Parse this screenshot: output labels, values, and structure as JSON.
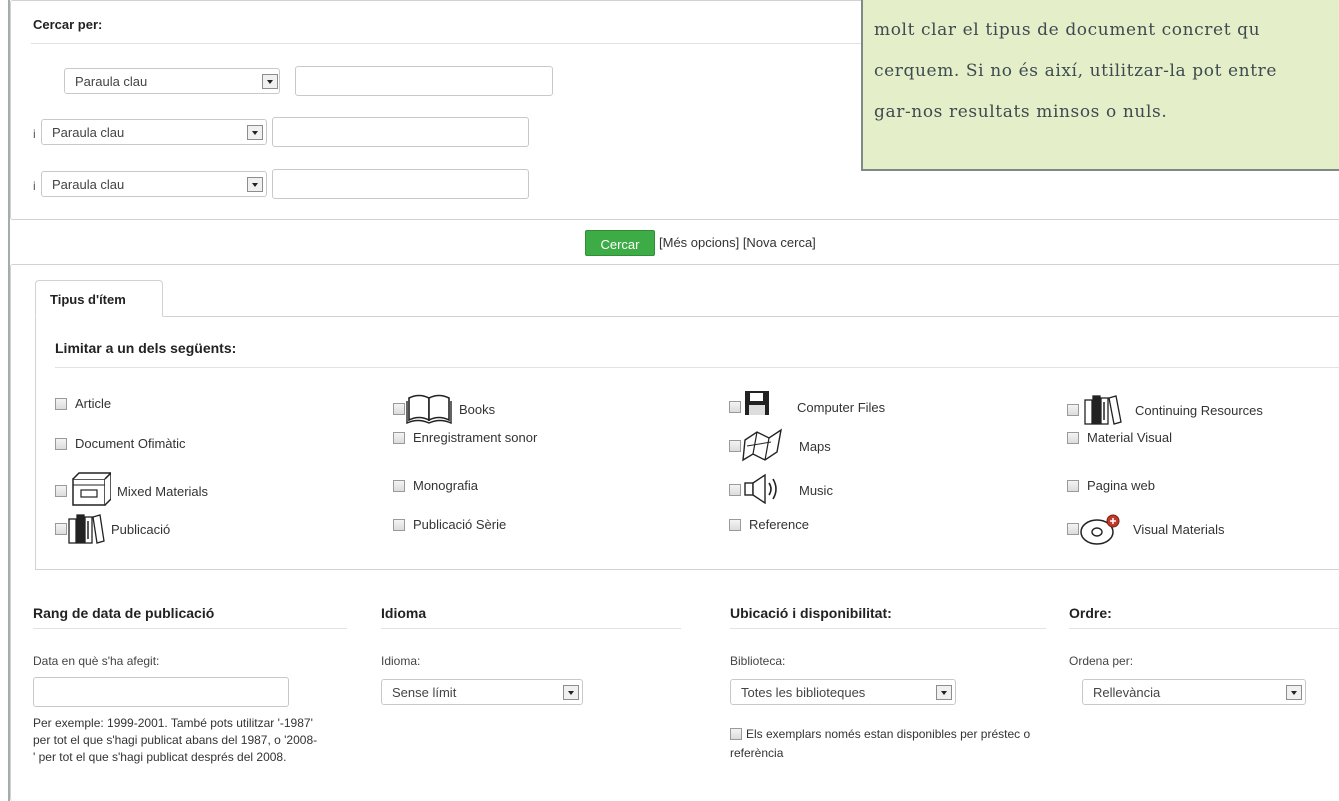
{
  "search": {
    "legend": "Cercar per:",
    "rows": [
      {
        "operator": "",
        "field": "Paraula clau",
        "value": ""
      },
      {
        "operator": "i",
        "field": "Paraula clau",
        "value": ""
      },
      {
        "operator": "i",
        "field": "Paraula clau",
        "value": ""
      }
    ],
    "button": "Cercar",
    "links": "[Més opcions] [Nova cerca]"
  },
  "callout": {
    "lines": [
      "molt clar el tipus de document concret qu",
      "cerquem. Si no és així, utilitzar-la pot entre",
      "gar-nos resultats minsos o nuls."
    ]
  },
  "types": {
    "tab": "Tipus d'ítem",
    "title": "Limitar a un dels següents:",
    "items": [
      {
        "label": "Article",
        "icon": "none"
      },
      {
        "label": "Document Ofimàtic",
        "icon": "none"
      },
      {
        "label": "Mixed Materials",
        "icon": "kit-box-icon",
        "caption": "KIT"
      },
      {
        "label": "Publicació",
        "icon": "journal-icon",
        "caption": "JOURNAL"
      },
      {
        "label": "Books",
        "icon": "book-icon",
        "caption": "BOOK"
      },
      {
        "label": "Enregistrament sonor",
        "icon": "none"
      },
      {
        "label": "Monografia",
        "icon": "none"
      },
      {
        "label": "Publicació Sèrie",
        "icon": "none"
      },
      {
        "label": "Computer Files",
        "icon": "computer-file-icon",
        "caption": "COMPUTER FILE"
      },
      {
        "label": "Maps",
        "icon": "map-icon",
        "caption": "MAP"
      },
      {
        "label": "Music",
        "icon": "sound-icon",
        "caption": "SOUND"
      },
      {
        "label": "Reference",
        "icon": "none"
      },
      {
        "label": "Continuing Resources",
        "icon": "periodical-icon",
        "caption": "PERIODICAL"
      },
      {
        "label": "Material Visual",
        "icon": "none"
      },
      {
        "label": "Pagina web",
        "icon": "none"
      },
      {
        "label": "Visual Materials",
        "icon": "dvd-icon",
        "caption": "DVD"
      }
    ]
  },
  "date": {
    "title": "Rang de data de publicació",
    "label": "Data en què s'ha afegit:",
    "value": "",
    "help": "Per exemple: 1999-2001. També pots utilitzar '-1987' per tot el que s'hagi publicat abans del 1987, o '2008-' per tot el que s'hagi publicat després del 2008."
  },
  "language": {
    "title": "Idioma",
    "label": "Idioma:",
    "selected": "Sense límit"
  },
  "location": {
    "title": "Ubicació i disponibilitat:",
    "label": "Biblioteca:",
    "selected": "Totes les biblioteques",
    "availability": "Els exemplars només estan disponibles per préstec o referència"
  },
  "order": {
    "title": "Ordre:",
    "label": "Ordena per:",
    "selected": "Rellevància"
  }
}
